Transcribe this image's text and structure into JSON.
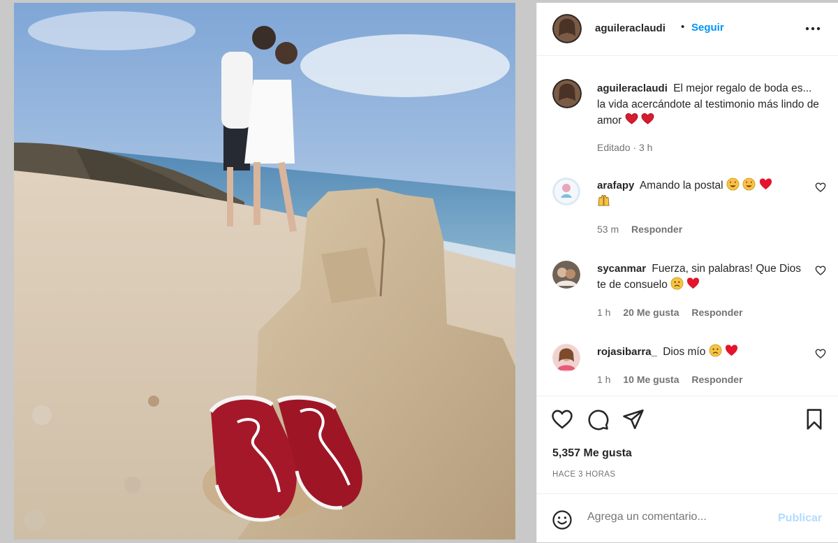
{
  "header": {
    "username": "aguileraclaudi",
    "separator": "•",
    "follow_label": "Seguir",
    "more_icon": "more-horizontal-icon"
  },
  "caption": {
    "username": "aguileraclaudi",
    "text": "El mejor regalo de boda es... la vida acercándote al testimonio más lindo de amor",
    "emoji": [
      "heart-emoji",
      "heart-emoji"
    ],
    "edited": "Editado",
    "dot": "·",
    "time": "3 h"
  },
  "comments": [
    {
      "username": "arafapy",
      "text": "Amando la postal",
      "emoji": [
        "heart-eyes-emoji",
        "heart-eyes-emoji",
        "red-heart-emoji",
        "raised-hands-emoji"
      ],
      "time": "53 m",
      "likes": "",
      "reply_label": "Responder"
    },
    {
      "username": "sycanmar",
      "text": "Fuerza, sin palabras! Que Dios te de consuelo",
      "emoji": [
        "sad-face-emoji",
        "red-heart-emoji"
      ],
      "time": "1 h",
      "likes": "20 Me gusta",
      "reply_label": "Responder"
    },
    {
      "username": "rojasibarra_",
      "text": "Dios mío",
      "emoji": [
        "sad-face-emoji",
        "red-heart-emoji"
      ],
      "time": "1 h",
      "likes": "10 Me gusta",
      "reply_label": "Responder"
    }
  ],
  "actions": {
    "icons": [
      "heart-icon",
      "comment-icon",
      "share-icon",
      "bookmark-icon"
    ],
    "likes": "5,357 Me gusta",
    "posted_ago": "HACE 3 HORAS"
  },
  "add_comment": {
    "placeholder": "Agrega un comentario...",
    "post_label": "Publicar"
  },
  "colors": {
    "link": "#0095f6",
    "muted": "#737373",
    "text": "#262626",
    "post_disabled": "#b3dbff",
    "heart": "#ed4956"
  }
}
